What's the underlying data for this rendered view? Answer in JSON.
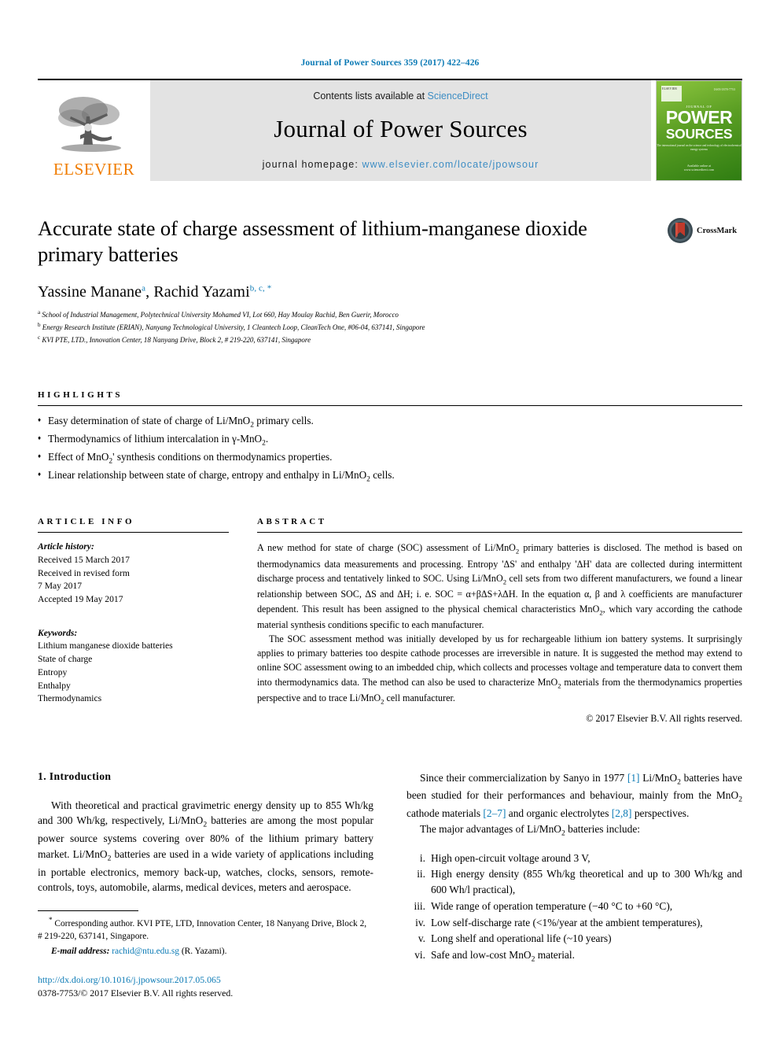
{
  "running_head": "Journal of Power Sources 359 (2017) 422–426",
  "masthead": {
    "contents_prefix": "Contents lists available at ",
    "sciencedirect": "ScienceDirect",
    "journal_name": "Journal of Power Sources",
    "homepage_prefix": "journal homepage: ",
    "homepage_url": "www.elsevier.com/locate/jpowsour",
    "publisher": "ELSEVIER",
    "cover": {
      "brand_small": "JOURNAL OF",
      "word1": "POWER",
      "word2": "SOURCES",
      "subtitle": "The international journal on the science and technology of electrochemical energy systems",
      "issn": "ISSN 0378-7753",
      "badge": "ELSEVIER",
      "footer": "Available online at\nwww.sciencedirect.com"
    }
  },
  "article": {
    "title": "Accurate state of charge assessment of lithium-manganese dioxide primary batteries",
    "crossmark_label": "CrossMark",
    "authors": [
      {
        "name": "Yassine Manane",
        "marks": "a"
      },
      {
        "name": "Rachid Yazami",
        "marks": "b, c, *"
      }
    ],
    "affiliations": [
      {
        "mark": "a",
        "text": "School of Industrial Management, Polytechnical University Mohamed VI, Lot 660, Hay Moulay Rachid, Ben Guerir, Morocco"
      },
      {
        "mark": "b",
        "text": "Energy Research Institute (ERIAN), Nanyang Technological University, 1 Cleantech Loop, CleanTech One, #06-04, 637141, Singapore"
      },
      {
        "mark": "c",
        "text": "KVI PTE, LTD., Innovation Center, 18 Nanyang Drive, Block 2, # 219-220, 637141, Singapore"
      }
    ]
  },
  "highlights": {
    "heading": "HIGHLIGHTS",
    "items": [
      "Easy determination of state of charge of Li/MnO2 primary cells.",
      "Thermodynamics of lithium intercalation in  γ-MnO2.",
      "Effect of MnO2' synthesis conditions on thermodynamics properties.",
      "Linear relationship between state of charge, entropy and enthalpy in Li/MnO2 cells."
    ]
  },
  "article_info": {
    "heading": "ARTICLE INFO",
    "history_label": "Article history:",
    "history": [
      "Received 15 March 2017",
      "Received in revised form",
      "7 May 2017",
      "Accepted 19 May 2017"
    ],
    "keywords_label": "Keywords:",
    "keywords": [
      "Lithium manganese dioxide batteries",
      "State of charge",
      "Entropy",
      "Enthalpy",
      "Thermodynamics"
    ]
  },
  "abstract": {
    "heading": "ABSTRACT",
    "paragraph1": "A new method for state of charge (SOC) assessment of Li/MnO2 primary batteries is disclosed. The method is based on thermodynamics data measurements and processing. Entropy 'ΔS' and enthalpy 'ΔH' data are collected during intermittent discharge process and tentatively linked to SOC. Using Li/MnO2 cell sets from two different manufacturers, we found a linear relationship between SOC, ΔS and ΔH; i. e. SOC = α+βΔS+λΔH. In the equation α, β and λ coefficients are manufacturer dependent. This result has been assigned to the physical chemical characteristics MnO2, which vary according the cathode material synthesis conditions specific to each manufacturer.",
    "paragraph2": "The SOC assessment method was initially developed by us for rechargeable lithium ion battery systems. It surprisingly applies to primary batteries too despite cathode processes are irreversible in nature. It is suggested the method may extend to online SOC assessment owing to an imbedded chip, which collects and processes voltage and temperature data to convert them into thermodynamics data. The method can also be used to characterize MnO2 materials from the thermodynamics properties perspective and to trace Li/MnO2 cell manufacturer.",
    "copyright": "© 2017 Elsevier B.V. All rights reserved."
  },
  "body": {
    "section_heading": "1. Introduction",
    "left_paragraph": "With theoretical and practical gravimetric energy density up to 855 Wh/kg and 300 Wh/kg, respectively, Li/MnO2 batteries are among the most popular power source systems covering over 80% of the lithium primary battery market. Li/MnO2 batteries are used in a wide variety of applications including in portable electronics, memory back-up, watches, clocks, sensors, remote-controls, toys, automobile, alarms, medical devices, meters and aerospace.",
    "right_paragraph_1_parts": {
      "a": "Since their commercialization by Sanyo in 1977 ",
      "cite1": "[1]",
      "b": " Li/MnO2 batteries have been studied for their performances and behaviour, mainly from the MnO2 cathode materials ",
      "cite2": "[2–7]",
      "c": " and organic electrolytes ",
      "cite3": "[2,8]",
      "d": " perspectives."
    },
    "right_paragraph_2": "The major advantages of Li/MnO2 batteries include:",
    "advantages": [
      {
        "num": "i.",
        "text": "High open-circuit voltage around 3 V,"
      },
      {
        "num": "ii.",
        "text": "High energy density (855 Wh/kg theoretical and up to 300 Wh/kg and 600 Wh/l practical),"
      },
      {
        "num": "iii.",
        "text": "Wide range of operation temperature (−40 °C to +60 °C),"
      },
      {
        "num": "iv.",
        "text": "Low self-discharge rate (<1%/year at the ambient temperatures),"
      },
      {
        "num": "v.",
        "text": "Long shelf and operational life (~10 years)"
      },
      {
        "num": "vi.",
        "text": "Safe and low-cost MnO2 material."
      }
    ]
  },
  "footnote": {
    "corresponding": "Corresponding author. KVI PTE, LTD, Innovation Center, 18 Nanyang Drive, Block 2, # 219-220, 637141, Singapore.",
    "email_label": "E-mail address:",
    "email": "rachid@ntu.edu.sg",
    "email_suffix": " (R. Yazami).",
    "doi": "http://dx.doi.org/10.1016/j.jpowsour.2017.05.065",
    "issn_line": "0378-7753/© 2017 Elsevier B.V. All rights reserved."
  },
  "colors": {
    "link_blue": "#0b7ab5",
    "sciencedirect_blue": "#3d8dc4",
    "elsevier_orange": "#f07c00",
    "masthead_gray": "#e3e3e3",
    "cover_green": "#5a9e23",
    "crossmark_red": "#c0392b"
  }
}
